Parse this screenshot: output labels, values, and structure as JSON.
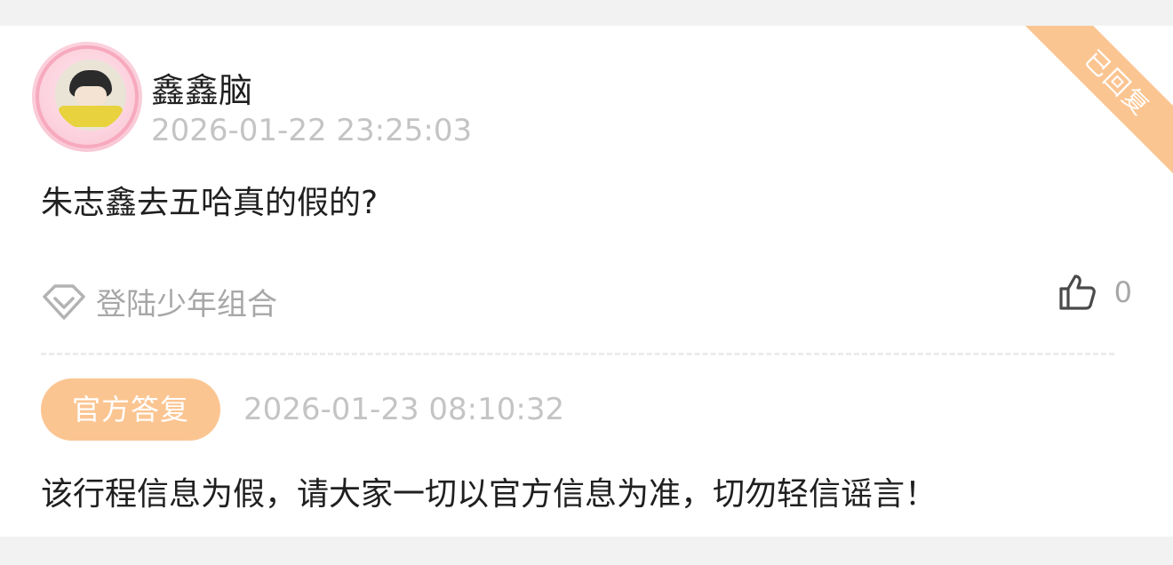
{
  "post": {
    "username": "鑫鑫脑",
    "timestamp": "2026-01-22 23:25:03",
    "question": "朱志鑫去五哈真的假的?",
    "status_ribbon": "已回复",
    "tag": {
      "icon": "diamond-icon",
      "label": "登陆少年组合"
    },
    "likes": {
      "icon": "thumbs-up-icon",
      "count": "0"
    }
  },
  "reply": {
    "badge": "官方答复",
    "timestamp": "2026-01-23 08:10:32",
    "text": "该行程信息为假，请大家一切以官方信息为准，切勿轻信谣言！"
  },
  "colors": {
    "accent": "#fbc592",
    "muted_text": "#a7a7a7",
    "timestamp_text": "#c4c4c4",
    "primary_text": "#1f1f1f"
  }
}
